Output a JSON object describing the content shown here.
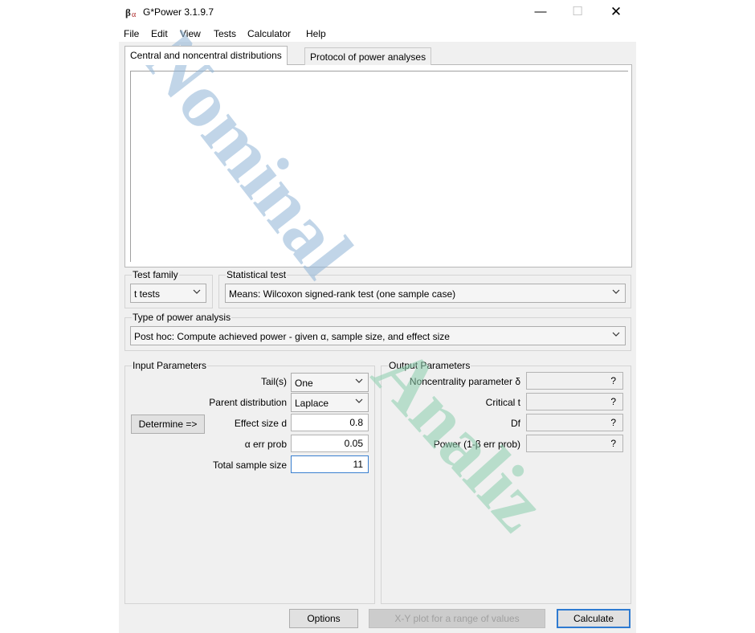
{
  "window": {
    "title": "G*Power 3.1.9.7",
    "icon": "gpower-app-icon",
    "controls": {
      "minimize": "—",
      "maximize": "☐",
      "close": "✕"
    }
  },
  "menu": {
    "file": "File",
    "edit": "Edit",
    "view": "View",
    "tests": "Tests",
    "calculator": "Calculator",
    "help": "Help"
  },
  "tabs": {
    "central": "Central and noncentral distributions",
    "protocol": "Protocol of power analyses"
  },
  "test_family": {
    "label": "Test family",
    "value": "t tests"
  },
  "statistical_test": {
    "label": "Statistical test",
    "value": "Means: Wilcoxon signed-rank test (one sample case)"
  },
  "power_analysis": {
    "label": "Type of power analysis",
    "value": "Post hoc: Compute achieved power - given α, sample size, and effect size"
  },
  "input": {
    "title": "Input Parameters",
    "tails_label": "Tail(s)",
    "tails_value": "One",
    "parent_label": "Parent distribution",
    "parent_value": "Laplace",
    "determine_button": "Determine =>",
    "effect_label": "Effect size d",
    "effect_value": "0.8",
    "alpha_label": "α err prob",
    "alpha_value": "0.05",
    "total_label": "Total sample size",
    "total_value": "11"
  },
  "output": {
    "title": "Output Parameters",
    "noncentrality_label": "Noncentrality parameter δ",
    "noncentrality_value": "?",
    "critical_label": "Critical t",
    "critical_value": "?",
    "df_label": "Df",
    "df_value": "?",
    "power_label": "Power (1-β err prob)",
    "power_value": "?"
  },
  "buttons": {
    "options": "Options",
    "xy_plot": "X-Y plot for a range of values",
    "calculate": "Calculate"
  },
  "watermark": {
    "line1": "Nominal",
    "line2": "Analiz",
    "color1": "#8fb4d6",
    "color2": "#8ccfae"
  }
}
